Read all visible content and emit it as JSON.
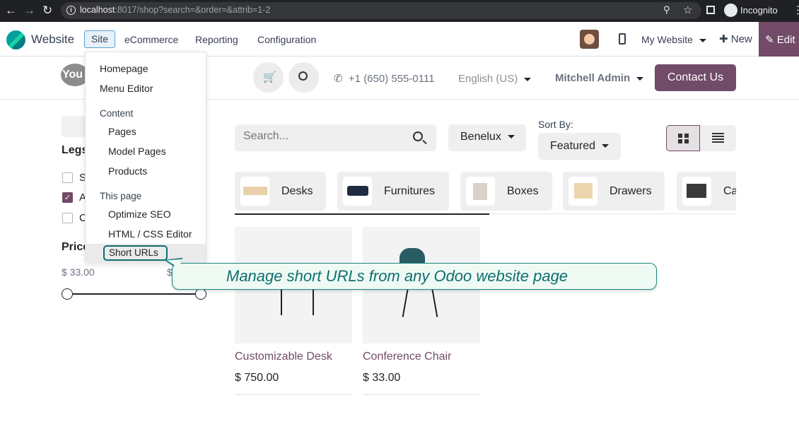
{
  "browser": {
    "url_host": "localhost",
    "url_rest": ":8017/shop?search=&order=&attrib=1-2",
    "profile_label": "Incognito"
  },
  "odoo": {
    "app_name": "Website",
    "menu": [
      "Site",
      "eCommerce",
      "Reporting",
      "Configuration"
    ],
    "my_website": "My Website",
    "new_label": "New",
    "edit_label": "Edit"
  },
  "header": {
    "phone": "+1 (650) 555-0111",
    "language": "English (US)",
    "user": "Mitchell Admin",
    "contact_label": "Contact Us",
    "logo_text": "You"
  },
  "sidebar": {
    "title": "Legs",
    "filters": [
      {
        "label": "S",
        "checked": false
      },
      {
        "label": "A",
        "checked": true
      },
      {
        "label": "C",
        "checked": false
      }
    ],
    "price_title": "Price",
    "price_min": "$ 33.00",
    "price_max": "$"
  },
  "toolbar": {
    "search_placeholder": "Search...",
    "pricelist": "Benelux",
    "sort_label": "Sort By:",
    "sort_value": "Featured"
  },
  "categories": [
    "Desks",
    "Furnitures",
    "Boxes",
    "Drawers",
    "Ca"
  ],
  "products": [
    {
      "name": "Customizable Desk",
      "price": "$ 750.00"
    },
    {
      "name": "Conference Chair",
      "price": "$ 33.00"
    }
  ],
  "dropdown": {
    "homepage": "Homepage",
    "menu_editor": "Menu Editor",
    "content_header": "Content",
    "pages": "Pages",
    "model_pages": "Model Pages",
    "products": "Products",
    "this_page_header": "This page",
    "optimize_seo": "Optimize SEO",
    "html_css_editor": "HTML / CSS Editor",
    "short_urls": "Short URLs"
  },
  "callout": {
    "text": "Manage short URLs from any Odoo website page"
  },
  "colors": {
    "brand": "#714b67",
    "callout_border": "#1a8a7d",
    "callout_text": "#0f6e6e"
  }
}
